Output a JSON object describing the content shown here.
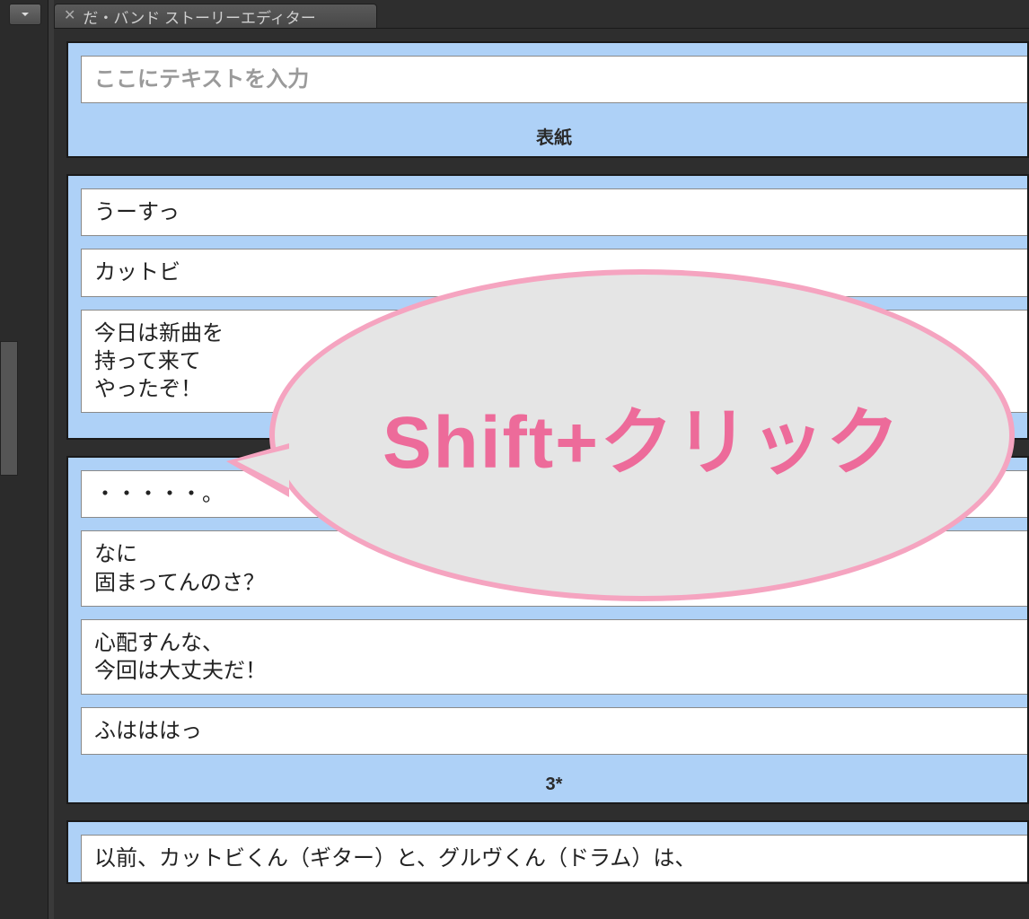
{
  "tab": {
    "title": "だ・バンド ストーリーエディター"
  },
  "pages": [
    {
      "footer": "表紙",
      "boxes": [
        {
          "placeholder": "ここにテキストを入力",
          "value": "",
          "is_placeholder": true
        }
      ]
    },
    {
      "footer": "",
      "boxes": [
        {
          "value": "うーすっ"
        },
        {
          "value": "カットビ"
        },
        {
          "value": "今日は新曲を\n持って来て\nやったぞ！"
        }
      ]
    },
    {
      "footer": "3*",
      "boxes": [
        {
          "value": "・・・・・。"
        },
        {
          "value": "なに\n固まってんのさ？"
        },
        {
          "value": "心配すんな、\n今回は大丈夫だ！"
        },
        {
          "value": "ふはははっ"
        }
      ]
    },
    {
      "footer": "",
      "boxes": [
        {
          "value": "以前、カットビくん（ギター）と、グルヴくん（ドラム）は、"
        }
      ]
    }
  ],
  "callout": {
    "text": "Shift+クリック"
  }
}
